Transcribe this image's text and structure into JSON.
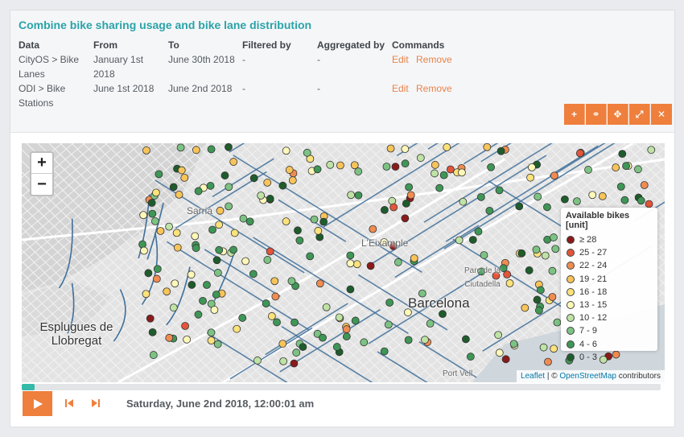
{
  "card": {
    "title": "Combine bike sharing usage and bike lane distribution",
    "columns": [
      "Data",
      "From",
      "To",
      "Filtered by",
      "Aggregated by",
      "Commands"
    ],
    "rows": [
      {
        "data": "CityOS > Bike Lanes",
        "from": "January 1st 2018",
        "to": "June 30th 2018",
        "filtered": "-",
        "aggregated": "-",
        "edit": "Edit",
        "remove": "Remove"
      },
      {
        "data": "ODI > Bike Stations",
        "from": "June 1st 2018",
        "to": "June 2nd 2018",
        "filtered": "-",
        "aggregated": "-",
        "edit": "Edit",
        "remove": "Remove"
      }
    ],
    "toolbar": [
      {
        "name": "add-button",
        "icon": "plus-icon",
        "glyph": "+"
      },
      {
        "name": "link-button",
        "icon": "link-icon",
        "glyph": "⚭"
      },
      {
        "name": "move-button",
        "icon": "move-icon",
        "glyph": "✥"
      },
      {
        "name": "expand-button",
        "icon": "expand-icon",
        "glyph": "⤢"
      },
      {
        "name": "close-button",
        "icon": "close-icon",
        "glyph": "✕"
      }
    ]
  },
  "map": {
    "zoom_in": "+",
    "zoom_out": "−",
    "places": {
      "barcelona": "Barcelona",
      "esplugues": "Esplugues de Llobregat",
      "sarria": "Sarrià",
      "eixample": "L'Eixample",
      "ciutadella": "Parc de la Ciutadella",
      "port_vell": "Port Vell"
    },
    "attribution": {
      "leaflet": "Leaflet",
      "sep": " | © ",
      "osm": "OpenStreetMap",
      "suffix": " contributors"
    },
    "legend": {
      "title": "Available bikes [unit]",
      "items": [
        {
          "label": "≥ 28",
          "color": "#8b1a1a"
        },
        {
          "label": "25 - 27",
          "color": "#e2553a"
        },
        {
          "label": "22 - 24",
          "color": "#f08c52"
        },
        {
          "label": "19 - 21",
          "color": "#f7c45a"
        },
        {
          "label": "16 - 18",
          "color": "#fbe27a"
        },
        {
          "label": "13 - 15",
          "color": "#fdf8b8"
        },
        {
          "label": "10 - 12",
          "color": "#bfe2a5"
        },
        {
          "label": "7 - 9",
          "color": "#7cc383"
        },
        {
          "label": "4 - 6",
          "color": "#3f9656"
        },
        {
          "label": "0 - 3",
          "color": "#1e5c2c"
        }
      ]
    }
  },
  "player": {
    "progress": 0.02,
    "accent": "#ef7f3c",
    "progress_color": "#35b9a8",
    "datetime": "Saturday, June 2nd 2018, 12:00:01 am"
  }
}
